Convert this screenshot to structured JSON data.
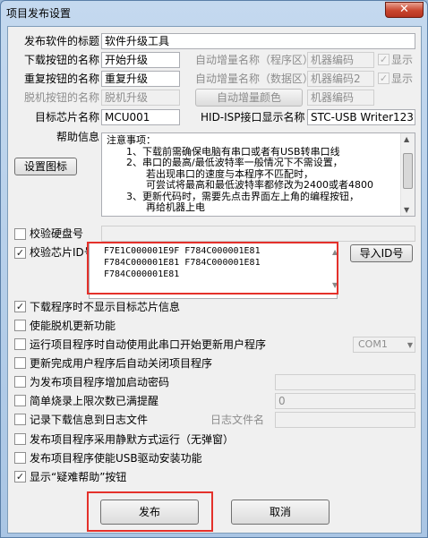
{
  "window": {
    "title": "项目发布设置",
    "close": "✕"
  },
  "fields": {
    "title_label": "发布软件的标题",
    "title_value": "软件升级工具",
    "download_label": "下载按钮的名称",
    "download_value": "开始升级",
    "retry_label": "重复按钮的名称",
    "retry_value": "重复升级",
    "offline_label": "脱机按钮的名称",
    "offline_value": "脱机升级",
    "auto_inc_prog_label": "自动增量名称（程序区）",
    "auto_inc_prog_value": "机器编码",
    "auto_inc_data_label": "自动增量名称（数据区）",
    "auto_inc_data_value": "机器编码2",
    "auto_inc_color_button": "自动增量颜色",
    "auto_inc_color_value": "机器编码",
    "show_label": "显示",
    "show_label2": "显示",
    "chip_label": "目标芯片名称",
    "chip_value": "MCU001",
    "hid_label": "HID-ISP接口显示名称",
    "hid_value": "STC-USB Writer123",
    "help_label": "帮助信息",
    "set_icon_button": "设置图标"
  },
  "help_text": [
    "注意事项：",
    "1、下载前需确保电脑有串口或者有USB转串口线",
    "2、串口的最高/最低波特率一般情况下不需设置，",
    "若出现串口的速度与本程序不匹配时，",
    "可尝试将最高和最低波特率都修改为2400或者4800",
    "3、更新代码时，需要先点击界面左上角的编程按钮，",
    "再给机器上电"
  ],
  "verify": {
    "disk_label": "校验硬盘号",
    "chip_id_label": "校验芯片ID号",
    "import_button": "导入ID号",
    "ids": [
      "F7E1C000001E9F F784C000001E81",
      "F784C000001E81 F784C000001E81",
      "F784C000001E81"
    ]
  },
  "options": [
    {
      "label": "下载程序时不显示目标芯片信息",
      "checked": true
    },
    {
      "label": "使能脱机更新功能",
      "checked": false
    },
    {
      "label": "运行项目程序时自动使用此串口开始更新用户程序",
      "checked": false
    },
    {
      "label": "更新完成用户程序后自动关闭项目程序",
      "checked": false
    },
    {
      "label": "为发布项目程序增加启动密码",
      "checked": false
    },
    {
      "label": "简单烧录上限次数已满提醒",
      "checked": false
    },
    {
      "label": "记录下载信息到日志文件",
      "checked": false
    },
    {
      "label": "发布项目程序采用静默方式运行（无弹窗）",
      "checked": false
    },
    {
      "label": "发布项目程序使能USB驱动安装功能",
      "checked": false
    },
    {
      "label": "显示“疑难帮助”按钮",
      "checked": true
    }
  ],
  "com_port": "COM1",
  "limit_value": "0",
  "log_label": "日志文件名",
  "buttons": {
    "publish": "发布",
    "cancel": "取消"
  },
  "colors": {
    "highlight_frame": "#e4312b",
    "title_bar": "#a9c5e4"
  }
}
